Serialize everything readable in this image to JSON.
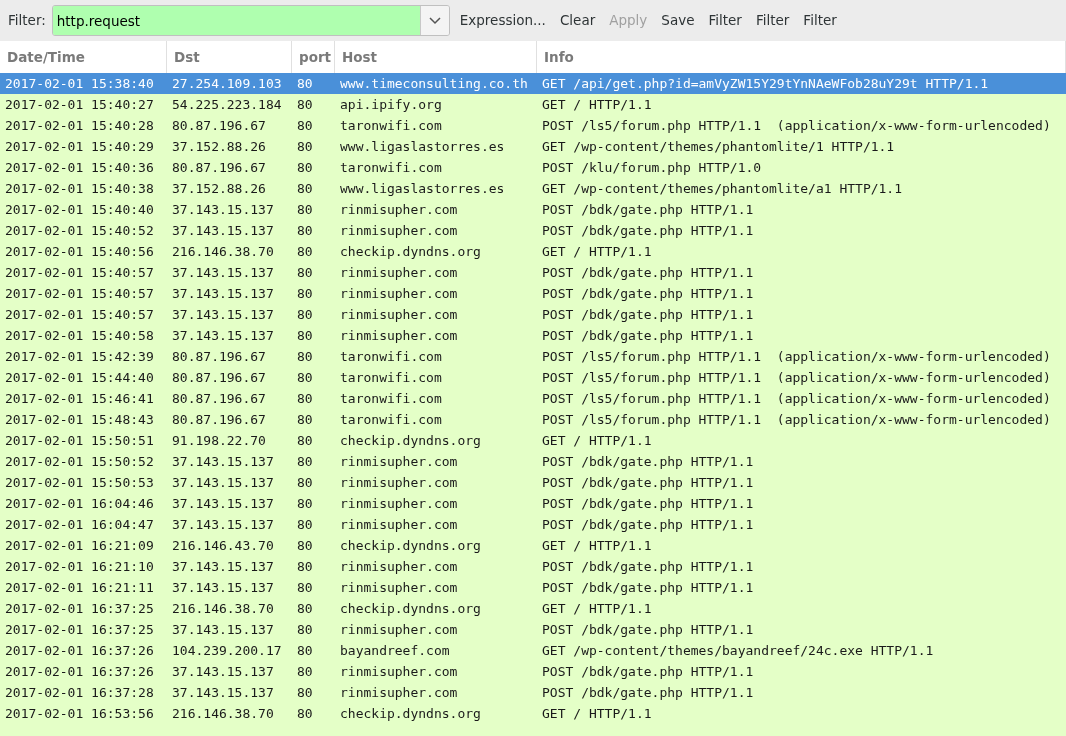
{
  "filter_bar": {
    "label": "Filter:",
    "value": "http.request",
    "buttons": [
      {
        "label": "Expression...",
        "disabled": false
      },
      {
        "label": "Clear",
        "disabled": false
      },
      {
        "label": "Apply",
        "disabled": true
      },
      {
        "label": "Save",
        "disabled": false
      },
      {
        "label": "Filter",
        "disabled": false
      },
      {
        "label": "Filter",
        "disabled": false
      },
      {
        "label": "Filter",
        "disabled": false
      }
    ]
  },
  "table": {
    "columns": [
      "Date/Time",
      "Dst",
      "port",
      "Host",
      "Info"
    ],
    "rows": [
      {
        "selected": true,
        "cells": [
          "2017-02-01 15:38:40",
          "27.254.109.103",
          "80",
          "www.timeconsulting.co.th",
          "GET /api/get.php?id=amVyZW15Y29tYnNAeWFob28uY29t HTTP/1.1"
        ]
      },
      {
        "selected": false,
        "cells": [
          "2017-02-01 15:40:27",
          "54.225.223.184",
          "80",
          "api.ipify.org",
          "GET / HTTP/1.1"
        ]
      },
      {
        "selected": false,
        "cells": [
          "2017-02-01 15:40:28",
          "80.87.196.67",
          "80",
          "taronwifi.com",
          "POST /ls5/forum.php HTTP/1.1  (application/x-www-form-urlencoded)"
        ]
      },
      {
        "selected": false,
        "cells": [
          "2017-02-01 15:40:29",
          "37.152.88.26",
          "80",
          "www.ligaslastorres.es",
          "GET /wp-content/themes/phantomlite/1 HTTP/1.1"
        ]
      },
      {
        "selected": false,
        "cells": [
          "2017-02-01 15:40:36",
          "80.87.196.67",
          "80",
          "taronwifi.com",
          "POST /klu/forum.php HTTP/1.0"
        ]
      },
      {
        "selected": false,
        "cells": [
          "2017-02-01 15:40:38",
          "37.152.88.26",
          "80",
          "www.ligaslastorres.es",
          "GET /wp-content/themes/phantomlite/a1 HTTP/1.1"
        ]
      },
      {
        "selected": false,
        "cells": [
          "2017-02-01 15:40:40",
          "37.143.15.137",
          "80",
          "rinmisupher.com",
          "POST /bdk/gate.php HTTP/1.1"
        ]
      },
      {
        "selected": false,
        "cells": [
          "2017-02-01 15:40:52",
          "37.143.15.137",
          "80",
          "rinmisupher.com",
          "POST /bdk/gate.php HTTP/1.1"
        ]
      },
      {
        "selected": false,
        "cells": [
          "2017-02-01 15:40:56",
          "216.146.38.70",
          "80",
          "checkip.dyndns.org",
          "GET / HTTP/1.1"
        ]
      },
      {
        "selected": false,
        "cells": [
          "2017-02-01 15:40:57",
          "37.143.15.137",
          "80",
          "rinmisupher.com",
          "POST /bdk/gate.php HTTP/1.1"
        ]
      },
      {
        "selected": false,
        "cells": [
          "2017-02-01 15:40:57",
          "37.143.15.137",
          "80",
          "rinmisupher.com",
          "POST /bdk/gate.php HTTP/1.1"
        ]
      },
      {
        "selected": false,
        "cells": [
          "2017-02-01 15:40:57",
          "37.143.15.137",
          "80",
          "rinmisupher.com",
          "POST /bdk/gate.php HTTP/1.1"
        ]
      },
      {
        "selected": false,
        "cells": [
          "2017-02-01 15:40:58",
          "37.143.15.137",
          "80",
          "rinmisupher.com",
          "POST /bdk/gate.php HTTP/1.1"
        ]
      },
      {
        "selected": false,
        "cells": [
          "2017-02-01 15:42:39",
          "80.87.196.67",
          "80",
          "taronwifi.com",
          "POST /ls5/forum.php HTTP/1.1  (application/x-www-form-urlencoded)"
        ]
      },
      {
        "selected": false,
        "cells": [
          "2017-02-01 15:44:40",
          "80.87.196.67",
          "80",
          "taronwifi.com",
          "POST /ls5/forum.php HTTP/1.1  (application/x-www-form-urlencoded)"
        ]
      },
      {
        "selected": false,
        "cells": [
          "2017-02-01 15:46:41",
          "80.87.196.67",
          "80",
          "taronwifi.com",
          "POST /ls5/forum.php HTTP/1.1  (application/x-www-form-urlencoded)"
        ]
      },
      {
        "selected": false,
        "cells": [
          "2017-02-01 15:48:43",
          "80.87.196.67",
          "80",
          "taronwifi.com",
          "POST /ls5/forum.php HTTP/1.1  (application/x-www-form-urlencoded)"
        ]
      },
      {
        "selected": false,
        "cells": [
          "2017-02-01 15:50:51",
          "91.198.22.70",
          "80",
          "checkip.dyndns.org",
          "GET / HTTP/1.1"
        ]
      },
      {
        "selected": false,
        "cells": [
          "2017-02-01 15:50:52",
          "37.143.15.137",
          "80",
          "rinmisupher.com",
          "POST /bdk/gate.php HTTP/1.1"
        ]
      },
      {
        "selected": false,
        "cells": [
          "2017-02-01 15:50:53",
          "37.143.15.137",
          "80",
          "rinmisupher.com",
          "POST /bdk/gate.php HTTP/1.1"
        ]
      },
      {
        "selected": false,
        "cells": [
          "2017-02-01 16:04:46",
          "37.143.15.137",
          "80",
          "rinmisupher.com",
          "POST /bdk/gate.php HTTP/1.1"
        ]
      },
      {
        "selected": false,
        "cells": [
          "2017-02-01 16:04:47",
          "37.143.15.137",
          "80",
          "rinmisupher.com",
          "POST /bdk/gate.php HTTP/1.1"
        ]
      },
      {
        "selected": false,
        "cells": [
          "2017-02-01 16:21:09",
          "216.146.43.70",
          "80",
          "checkip.dyndns.org",
          "GET / HTTP/1.1"
        ]
      },
      {
        "selected": false,
        "cells": [
          "2017-02-01 16:21:10",
          "37.143.15.137",
          "80",
          "rinmisupher.com",
          "POST /bdk/gate.php HTTP/1.1"
        ]
      },
      {
        "selected": false,
        "cells": [
          "2017-02-01 16:21:11",
          "37.143.15.137",
          "80",
          "rinmisupher.com",
          "POST /bdk/gate.php HTTP/1.1"
        ]
      },
      {
        "selected": false,
        "cells": [
          "2017-02-01 16:37:25",
          "216.146.38.70",
          "80",
          "checkip.dyndns.org",
          "GET / HTTP/1.1"
        ]
      },
      {
        "selected": false,
        "cells": [
          "2017-02-01 16:37:25",
          "37.143.15.137",
          "80",
          "rinmisupher.com",
          "POST /bdk/gate.php HTTP/1.1"
        ]
      },
      {
        "selected": false,
        "cells": [
          "2017-02-01 16:37:26",
          "104.239.200.17",
          "80",
          "bayandreef.com",
          "GET /wp-content/themes/bayandreef/24c.exe HTTP/1.1"
        ]
      },
      {
        "selected": false,
        "cells": [
          "2017-02-01 16:37:26",
          "37.143.15.137",
          "80",
          "rinmisupher.com",
          "POST /bdk/gate.php HTTP/1.1"
        ]
      },
      {
        "selected": false,
        "cells": [
          "2017-02-01 16:37:28",
          "37.143.15.137",
          "80",
          "rinmisupher.com",
          "POST /bdk/gate.php HTTP/1.1"
        ]
      },
      {
        "selected": false,
        "cells": [
          "2017-02-01 16:53:56",
          "216.146.38.70",
          "80",
          "checkip.dyndns.org",
          "GET / HTTP/1.1"
        ]
      }
    ]
  }
}
